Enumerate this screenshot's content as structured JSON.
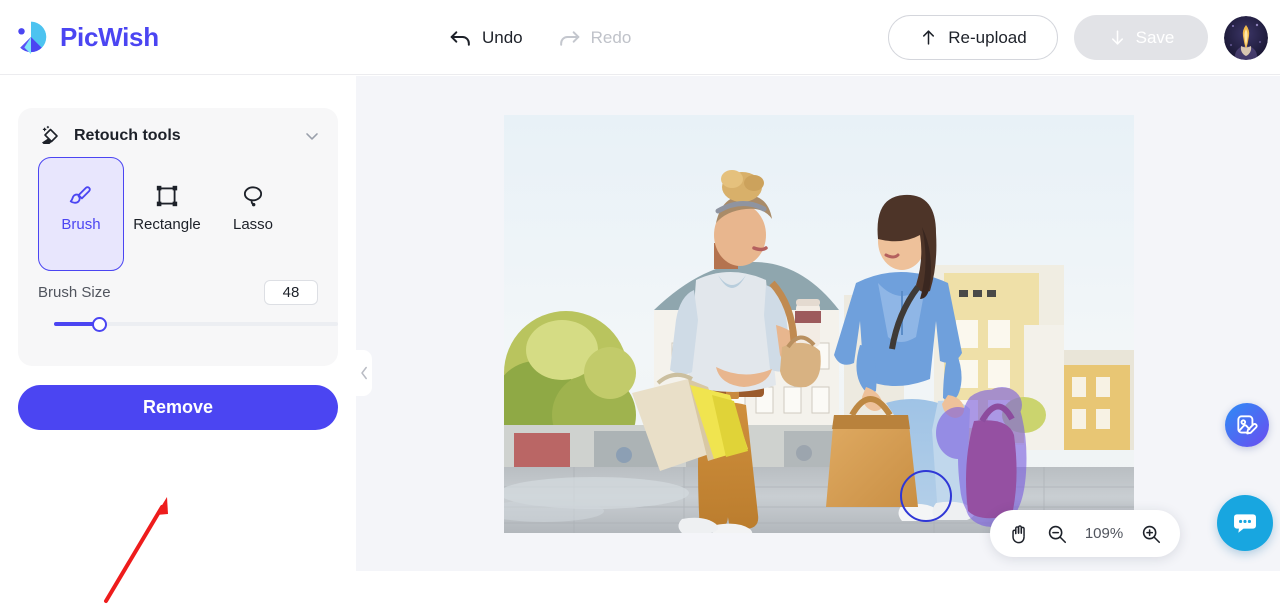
{
  "app": {
    "brand_name": "PicWish",
    "brand_icon": "picwish-logo-icon"
  },
  "header": {
    "undo": {
      "label": "Undo",
      "icon": "undo-arrow-icon",
      "enabled": true
    },
    "redo": {
      "label": "Redo",
      "icon": "redo-arrow-icon",
      "enabled": false
    },
    "reupload": {
      "label": "Re-upload",
      "icon": "arrow-up-icon"
    },
    "save": {
      "label": "Save",
      "icon": "arrow-down-icon",
      "enabled": false
    },
    "avatar": {
      "icon": "user-avatar"
    }
  },
  "sidebar": {
    "panel": {
      "title": "Retouch tools",
      "icon": "eraser-sparkle-icon",
      "collapse_icon": "chevron-down-icon",
      "tools": [
        {
          "label": "Brush",
          "icon": "brush-icon",
          "selected": true
        },
        {
          "label": "Rectangle",
          "icon": "rectangle-icon",
          "selected": false
        },
        {
          "label": "Lasso",
          "icon": "lasso-icon",
          "selected": false
        }
      ],
      "brush_size": {
        "label": "Brush Size",
        "value": "48",
        "slider_percent": 16
      }
    },
    "remove_button": {
      "label": "Remove"
    },
    "annotation": {
      "icon": "red-arrow-annotation"
    }
  },
  "canvas": {
    "panel_toggle_icon": "chevron-left-icon",
    "photo": {
      "icon": "photo-two-women-shopping",
      "mask_color": "#7b5fe0",
      "brush_cursor_icon": "brush-cursor-circle"
    },
    "zoombar": {
      "hand_icon": "hand-tool-icon",
      "zoom_out_icon": "magnifier-minus-icon",
      "zoom_level": "109%",
      "zoom_in_icon": "magnifier-plus-icon"
    },
    "edit_fab": {
      "icon": "image-edit-icon"
    },
    "chat_fab": {
      "icon": "chat-bubble-icon"
    }
  },
  "colors": {
    "accent": "#4b45f2",
    "accent_soft": "#e8e6fd",
    "canvas_bg": "#f4f5f9",
    "panel_bg": "#f7f7f8",
    "chat_blue": "#18a6e0",
    "annotation_red": "#ee1c1c"
  }
}
